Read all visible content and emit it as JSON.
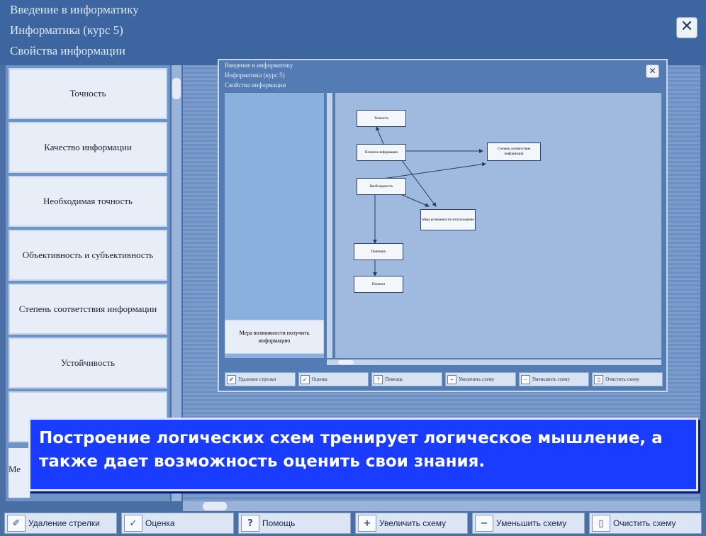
{
  "window": {
    "title": [
      "Введение в информатику",
      "Информатика (курс 5)",
      "Свойства информации"
    ],
    "close_glyph": "✕"
  },
  "left_items": [
    "Точность",
    "Качество информации",
    "Необходимая точность",
    "Объективность и субъективность",
    "Степень соответствия информации",
    "Устойчивость"
  ],
  "left_peek": "Ме",
  "inner_window": {
    "title": [
      "Введение в информатику",
      "Информатика (курс 5)",
      "Свойства информации"
    ],
    "close_glyph": "✕",
    "left_caption": "Мера возможности получить информацию",
    "nodes": [
      "Точность",
      "Полнота информации",
      "Степень соответствия информации",
      "Необходимость",
      "Мера возможности использования",
      "Понимать",
      "Полнота"
    ],
    "toolbar": [
      {
        "icon": "✐",
        "label": "Удаление стрелки"
      },
      {
        "icon": "✓",
        "label": "Оценка"
      },
      {
        "icon": "?",
        "label": "Помощь"
      },
      {
        "icon": "+",
        "label": "Увеличить схему"
      },
      {
        "icon": "−",
        "label": "Уменьшить схему"
      },
      {
        "icon": "▯",
        "label": "Очистить схему"
      }
    ]
  },
  "toolbar": [
    {
      "icon": "✐",
      "label": "Удаление стрелки"
    },
    {
      "icon": "✓",
      "label": "Оценка"
    },
    {
      "icon": "?",
      "label": "Помощь"
    },
    {
      "icon": "+",
      "label": "Увеличить схему"
    },
    {
      "icon": "−",
      "label": "Уменьшить схему"
    },
    {
      "icon": "▯",
      "label": "Очистить схему"
    }
  ],
  "banner": "Построение логических схем тренирует логическое мышление, а также дает возможность оценить свои знания."
}
